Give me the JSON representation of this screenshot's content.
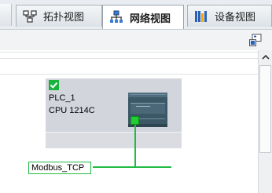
{
  "tabs": [
    {
      "label": "拓扑视图",
      "icon": "topology-view-icon",
      "active": false
    },
    {
      "label": "网络视图",
      "icon": "network-view-icon",
      "active": true
    },
    {
      "label": "设备视图",
      "icon": "device-view-icon",
      "active": false
    }
  ],
  "device": {
    "name": "PLC_1",
    "type": "CPU 1214C",
    "status_icon": "check-icon"
  },
  "network": {
    "label": "Modbus_TCP"
  },
  "colors": {
    "accent_green": "#22bb44",
    "check_green": "#19b33c",
    "device_bg": "#d3d5dc",
    "plc_body": "#3c5866"
  },
  "toolbar": {
    "icon": "show-overview-icon"
  }
}
